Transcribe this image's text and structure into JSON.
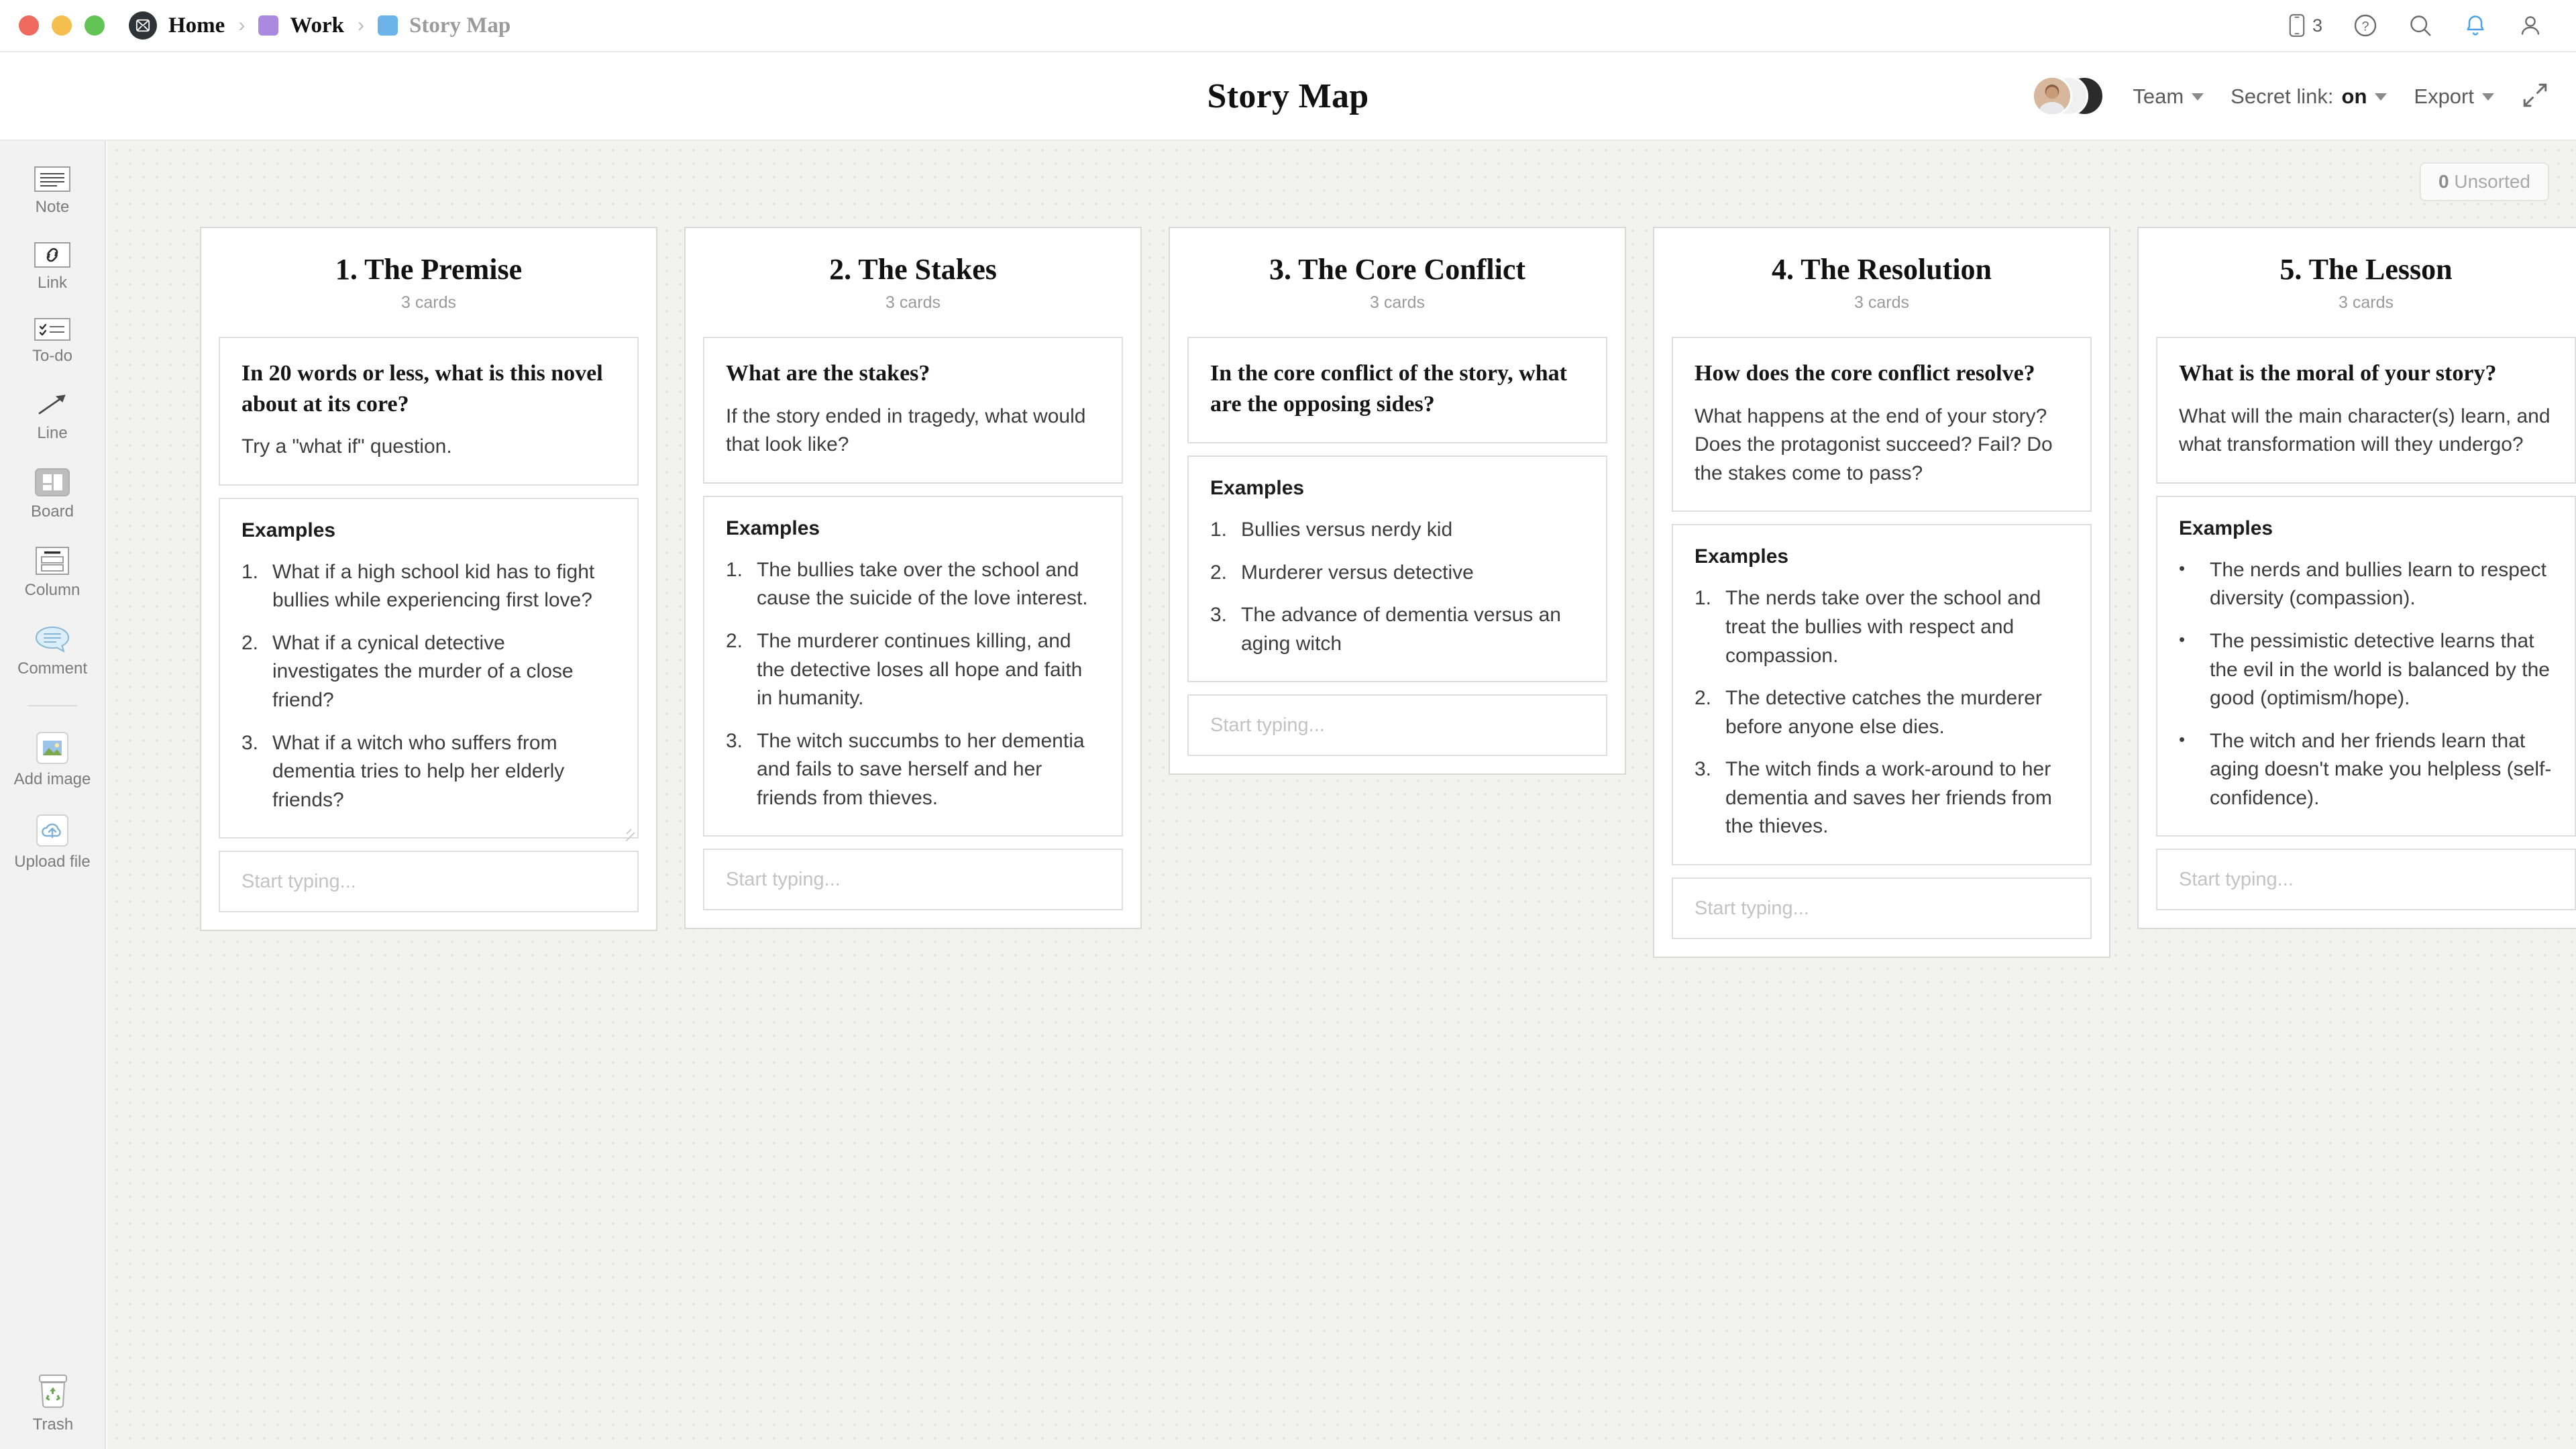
{
  "titlebar": {
    "breadcrumb": [
      {
        "label": "Home",
        "icon": "app-logo-icon",
        "chip_color": ""
      },
      {
        "label": "Work",
        "icon": "folder-chip-icon",
        "chip_color": "#a98ae0"
      },
      {
        "label": "Story Map",
        "icon": "board-chip-icon",
        "chip_color": "#6bb3e8"
      }
    ],
    "separator": "›",
    "icons": [
      {
        "name": "phone-icon",
        "badge": "3"
      },
      {
        "name": "help-icon",
        "badge": ""
      },
      {
        "name": "search-icon",
        "badge": ""
      },
      {
        "name": "notification-bell-icon",
        "badge": ""
      },
      {
        "name": "user-account-icon",
        "badge": ""
      }
    ]
  },
  "subheader": {
    "title": "Story Map",
    "team_label": "Team",
    "secret_link_prefix": "Secret link: ",
    "secret_link_value": "on",
    "export_label": "Export",
    "expand_icon": "expand-collapse-icon"
  },
  "sidebar": {
    "tools": [
      {
        "label": "Note",
        "icon": "note-icon",
        "selected": false
      },
      {
        "label": "Link",
        "icon": "link-icon",
        "selected": false
      },
      {
        "label": "To-do",
        "icon": "todo-icon",
        "selected": false
      },
      {
        "label": "Line",
        "icon": "line-arrow-icon",
        "selected": false
      },
      {
        "label": "Board",
        "icon": "board-icon",
        "selected": true
      },
      {
        "label": "Column",
        "icon": "column-icon",
        "selected": false
      },
      {
        "label": "Comment",
        "icon": "comment-icon",
        "selected": false
      },
      {
        "label": "Add image",
        "icon": "add-image-icon",
        "selected": false
      },
      {
        "label": "Upload file",
        "icon": "upload-file-icon",
        "selected": false
      }
    ],
    "trash": {
      "label": "Trash",
      "icon": "trash-icon"
    }
  },
  "canvas": {
    "unsorted_count": "0",
    "unsorted_label": "Unsorted",
    "placeholder_text": "Start typing...",
    "examples_heading": "Examples",
    "columns": [
      {
        "title": "1. The Premise",
        "card_count": "3 cards",
        "prompt_title": "In 20 words or less, what is this novel about at its core?",
        "prompt_body": "Try a \"what if\" question.",
        "list_style": "ordered",
        "examples": [
          "What if a high school kid has to fight bullies while experiencing first love?",
          "What if a cynical detective investigates the murder of a close friend?",
          "What if a witch who suffers from dementia tries to help her elderly friends?"
        ]
      },
      {
        "title": "2. The Stakes",
        "card_count": "3 cards",
        "prompt_title": "What are the stakes?",
        "prompt_body": "If the story ended in tragedy, what would that look like?",
        "list_style": "ordered",
        "examples": [
          "The bullies take over the school and cause the suicide of the love interest.",
          "The murderer continues killing, and the detective loses all hope and faith in humanity.",
          "The witch succumbs to her dementia and fails to save herself and her friends from thieves."
        ]
      },
      {
        "title": "3. The Core Conflict",
        "card_count": "3 cards",
        "prompt_title": "In the core conflict of the story, what are the opposing sides?",
        "prompt_body": "",
        "list_style": "ordered",
        "examples": [
          "Bullies versus nerdy kid",
          "Murderer versus detective",
          "The advance of dementia versus an aging witch"
        ]
      },
      {
        "title": "4. The Resolution",
        "card_count": "3 cards",
        "prompt_title": "How does the core conflict resolve?",
        "prompt_body": "What happens at the end of your story? Does the protagonist succeed? Fail? Do the stakes come to pass?",
        "list_style": "ordered",
        "examples": [
          "The nerds take over the school and treat the bullies with respect and compassion.",
          "The detective catches the murderer before anyone else dies.",
          "The witch finds a work-around to her  dementia and saves her friends from the thieves."
        ]
      },
      {
        "title": "5. The Lesson",
        "card_count": "3 cards",
        "prompt_title": "What is the moral of your story?",
        "prompt_body": "What will the main character(s) learn, and what transformation will they undergo?",
        "list_style": "bulleted",
        "examples": [
          "The nerds and bullies learn to respect diversity (compassion).",
          "The pessimistic detective learns that the evil in the world is balanced by the good (optimism/hope).",
          "The witch and her friends learn that aging doesn't make you helpless (self-confidence)."
        ]
      }
    ]
  },
  "colors": {
    "accent_blue": "#4aa3e8",
    "chip_purple": "#a98ae0",
    "chip_blue": "#6bb3e8",
    "canvas": "#f2f2f0",
    "trash_green": "#6aa84f"
  }
}
